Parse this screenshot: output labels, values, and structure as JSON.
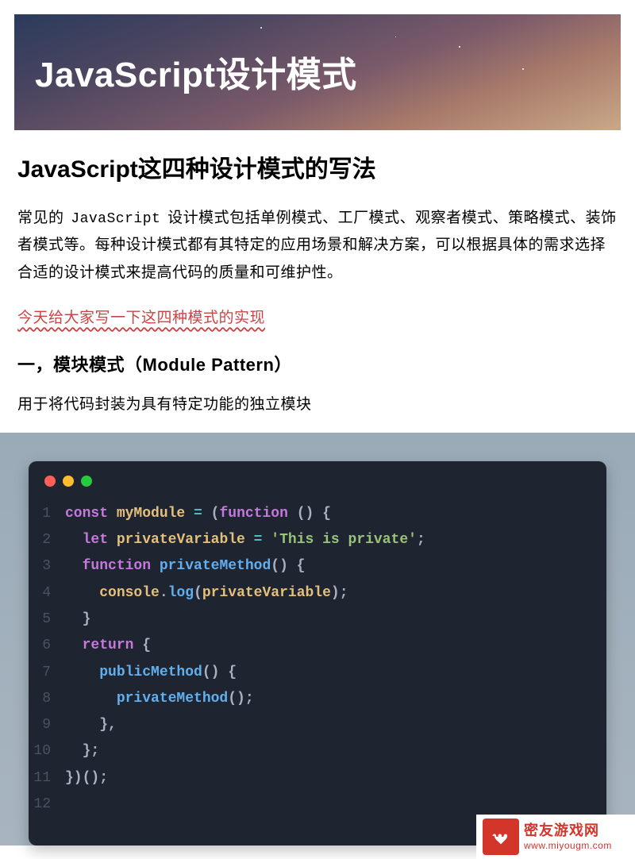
{
  "banner": {
    "title": "JavaScript设计模式"
  },
  "article": {
    "heading": "JavaScript这四种设计模式的写法",
    "intro_prefix": "常见的 ",
    "intro_code": "JavaScript",
    "intro_suffix": " 设计模式包括单例模式、工厂模式、观察者模式、策略模式、装饰者模式等。每种设计模式都有其特定的应用场景和解决方案，可以根据具体的需求选择合适的设计模式来提高代码的质量和可维护性。",
    "red_note": "今天给大家写一下这四种模式的实现",
    "section1": {
      "title": "一，模块模式（Module Pattern）",
      "desc": "用于将代码封装为具有特定功能的独立模块"
    }
  },
  "code": {
    "lines": [
      [
        {
          "t": "const ",
          "c": "kw"
        },
        {
          "t": "myModule",
          "c": "id"
        },
        {
          "t": " ",
          "c": "pn"
        },
        {
          "t": "=",
          "c": "op"
        },
        {
          "t": " (",
          "c": "pn"
        },
        {
          "t": "function",
          "c": "kw"
        },
        {
          "t": " () {",
          "c": "pn"
        }
      ],
      [
        {
          "t": "  ",
          "c": "pn"
        },
        {
          "t": "let ",
          "c": "kw"
        },
        {
          "t": "privateVariable",
          "c": "id"
        },
        {
          "t": " ",
          "c": "pn"
        },
        {
          "t": "=",
          "c": "op"
        },
        {
          "t": " ",
          "c": "pn"
        },
        {
          "t": "'This is private'",
          "c": "str"
        },
        {
          "t": ";",
          "c": "pn"
        }
      ],
      [
        {
          "t": "  ",
          "c": "pn"
        },
        {
          "t": "function ",
          "c": "kw"
        },
        {
          "t": "privateMethod",
          "c": "fn"
        },
        {
          "t": "() {",
          "c": "pn"
        }
      ],
      [
        {
          "t": "    ",
          "c": "pn"
        },
        {
          "t": "console",
          "c": "obj"
        },
        {
          "t": ".",
          "c": "pn"
        },
        {
          "t": "log",
          "c": "fn"
        },
        {
          "t": "(",
          "c": "pn"
        },
        {
          "t": "privateVariable",
          "c": "id"
        },
        {
          "t": ");",
          "c": "pn"
        }
      ],
      [
        {
          "t": "  }",
          "c": "pn"
        }
      ],
      [
        {
          "t": "  ",
          "c": "pn"
        },
        {
          "t": "return",
          "c": "kw"
        },
        {
          "t": " {",
          "c": "pn"
        }
      ],
      [
        {
          "t": "    ",
          "c": "pn"
        },
        {
          "t": "publicMethod",
          "c": "fn"
        },
        {
          "t": "() {",
          "c": "pn"
        }
      ],
      [
        {
          "t": "      ",
          "c": "pn"
        },
        {
          "t": "privateMethod",
          "c": "fn"
        },
        {
          "t": "();",
          "c": "pn"
        }
      ],
      [
        {
          "t": "    },",
          "c": "pn"
        }
      ],
      [
        {
          "t": "  };",
          "c": "pn"
        }
      ],
      [
        {
          "t": "})();",
          "c": "pn"
        }
      ],
      [
        {
          "t": "",
          "c": "pn"
        }
      ]
    ]
  },
  "watermark": {
    "name": "密友游戏网",
    "url": "www.miyougm.com"
  }
}
